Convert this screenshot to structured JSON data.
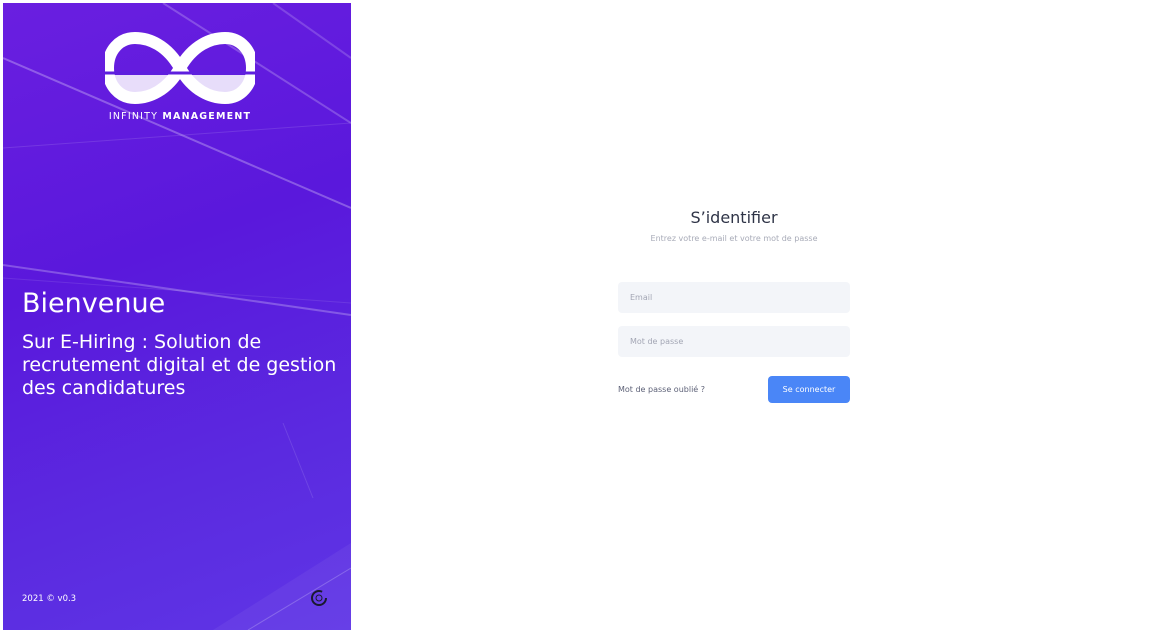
{
  "brand": {
    "logo_icon": "infinity-logo-icon",
    "name_light": "INFINITY",
    "name_bold": "MANAGEMENT"
  },
  "welcome": {
    "title": "Bienvenue",
    "subtitle": "Sur E-Hiring : Solution de recrutement digital et de gestion des candidatures"
  },
  "footer": {
    "version": "2021 © v0.3",
    "corner_icon": "loading-spinner-icon"
  },
  "login": {
    "title": "S’identifier",
    "subtitle": "Entrez votre e-mail et votre mot de passe",
    "email_placeholder": "Email",
    "email_value": "",
    "password_placeholder": "Mot de passe",
    "password_value": "",
    "forgot_label": "Mot de passe oublié ?",
    "submit_label": "Se connecter"
  },
  "colors": {
    "panel_primary": "#5a18dc",
    "button_primary": "#4a86f7",
    "field_background": "#f3f5f9",
    "title_text": "#2f3447"
  }
}
